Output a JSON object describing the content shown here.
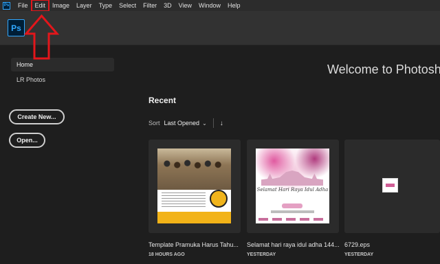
{
  "menubar": {
    "app_icon_text": "Ps",
    "items": [
      "File",
      "Edit",
      "Image",
      "Layer",
      "Type",
      "Select",
      "Filter",
      "3D",
      "View",
      "Window",
      "Help"
    ],
    "highlighted_item": "Edit",
    "highlight_color": "#e3161b"
  },
  "appbar": {
    "logo_text": "Ps"
  },
  "sidebar": {
    "items": [
      {
        "label": "Home"
      },
      {
        "label": "LR Photos"
      }
    ],
    "buttons": {
      "create_new": "Create New...",
      "open": "Open..."
    }
  },
  "main": {
    "welcome": "Welcome to Photoshop",
    "recent_title": "Recent",
    "sort_label": "Sort",
    "sort_value": "Last Opened",
    "sort_chevron": "⌄",
    "sort_direction_icon": "↓",
    "recent_files": [
      {
        "name": "Template Pramuka Harus Tahu...",
        "time": "18 HOURS AGO"
      },
      {
        "name": "Selamat hari raya idul adha 144...",
        "time": "YESTERDAY"
      },
      {
        "name": "6729.eps",
        "time": "YESTERDAY"
      }
    ]
  },
  "thumbnail_text": {
    "idul_adha": "Selamat Hari Raya Idul Adha",
    "year": "1440 H"
  },
  "colors": {
    "ps_blue": "#31a8ff",
    "ps_dark": "#001e36",
    "annotation_red": "#e3161b"
  }
}
